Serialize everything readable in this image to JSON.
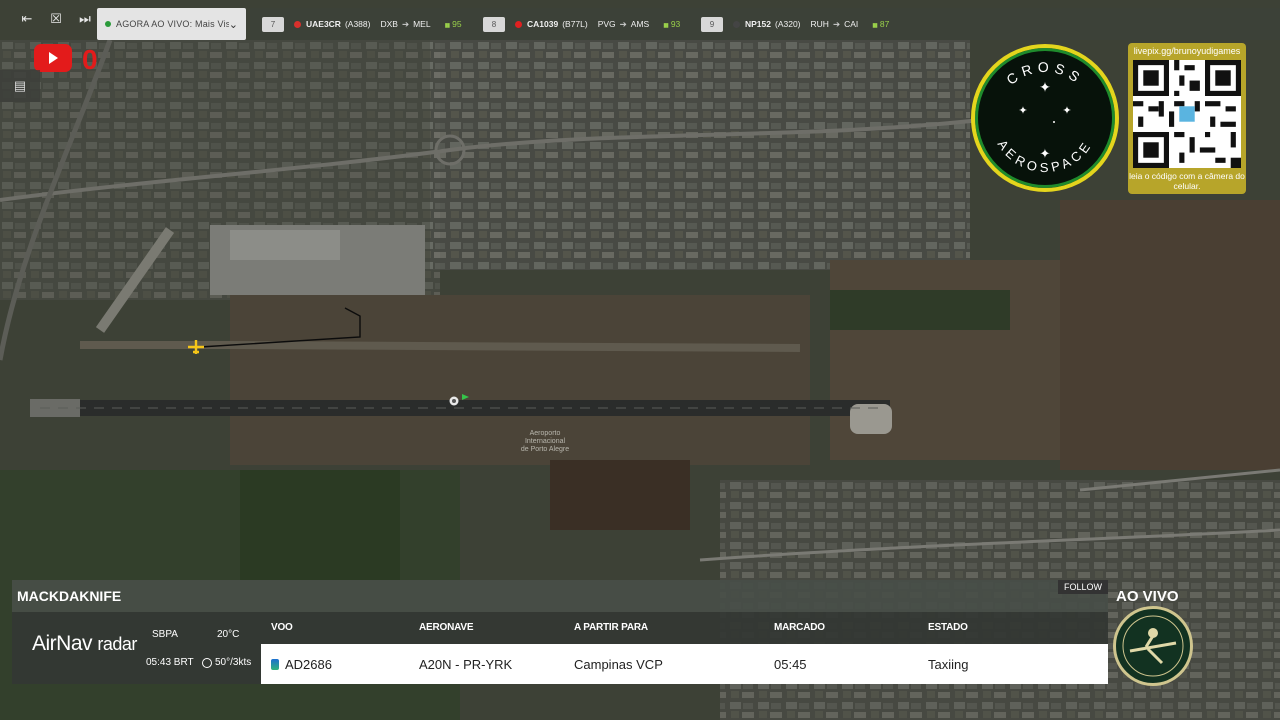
{
  "topbar": {
    "playlist_label": "AGORA AO VIVO: Mais Vistos",
    "flights": [
      {
        "rank": "7",
        "code": "UAE3CR",
        "aircraft": "(A388)",
        "from": "DXB",
        "to": "MEL",
        "score": "95",
        "color": "#d9302c"
      },
      {
        "rank": "8",
        "code": "CA1039",
        "aircraft": "(B77L)",
        "from": "PVG",
        "to": "AMS",
        "score": "93",
        "color": "#e02020"
      },
      {
        "rank": "9",
        "code": "NP152",
        "aircraft": "(A320)",
        "from": "RUH",
        "to": "CAI",
        "score": "87",
        "color": "#444444"
      }
    ]
  },
  "youtube": {
    "count": "0"
  },
  "logo": {
    "top_text": "CROSS",
    "bottom_text": "AEROSPACE"
  },
  "qr": {
    "url": "livepix.gg/brunoyudigames",
    "caption": "leia o código com a câmera do celular."
  },
  "panel": {
    "username": "MACKDAKNIFE",
    "follow_label": "FOLLOW",
    "brand": "AirNav",
    "brand_suffix": "radar",
    "airport": "SBPA",
    "time": "05:43 BRT",
    "temp": "20°C",
    "wind": "50°/3kts",
    "columns": [
      "VOO",
      "AERONAVE",
      "A PARTIR PARA",
      "MARCADO",
      "ESTADO"
    ],
    "row": {
      "flight": "AD2686",
      "aircraft": "A20N - PR-YRK",
      "destination": "Campinas VCP",
      "scheduled": "05:45",
      "status": "Taxiing"
    }
  },
  "live_label": "AO VIVO"
}
